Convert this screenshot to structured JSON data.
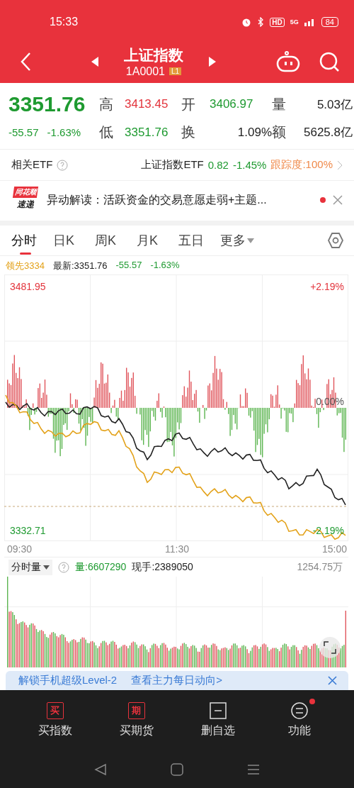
{
  "status_bar": {
    "time": "15:33",
    "hd": "HD",
    "network": "5G",
    "battery": "84"
  },
  "nav": {
    "title": "上证指数",
    "code": "1A0001",
    "level_badge": "L1"
  },
  "quote": {
    "price": "3351.76",
    "change": "-55.57",
    "change_pct": "-1.63%",
    "color": "#1e9a30",
    "stats": [
      {
        "label": "高",
        "value": "3413.45",
        "color": "#e3343c"
      },
      {
        "label": "开",
        "value": "3406.97",
        "color": "#1e9a30"
      },
      {
        "label": "量",
        "value": "5.03亿",
        "color": "#222222"
      },
      {
        "label": "低",
        "value": "3351.76",
        "color": "#1e9a30"
      },
      {
        "label": "换",
        "value": "1.09%",
        "color": "#222222"
      },
      {
        "label": "额",
        "value": "5625.8亿",
        "color": "#222222"
      }
    ]
  },
  "etf": {
    "label": "相关ETF",
    "name": "上证指数ETF",
    "price": "0.82",
    "change": "-1.45%",
    "tracking": "跟踪度:100%"
  },
  "news": {
    "logo_top": "同花顺",
    "logo_bottom": "速递",
    "text": "异动解读：活跃资金的交易意愿走弱+主题...",
    "unread": true
  },
  "tabs": [
    {
      "label": "分时",
      "selected": true
    },
    {
      "label": "日K",
      "selected": false
    },
    {
      "label": "周K",
      "selected": false
    },
    {
      "label": "月K",
      "selected": false
    },
    {
      "label": "五日",
      "selected": false
    },
    {
      "label": "更多",
      "selected": false,
      "dropdown": true
    }
  ],
  "chart_info": {
    "leader": "领先3334",
    "latest": "最新:3351.76",
    "change": "-55.57",
    "change_pct": "-1.63%"
  },
  "chart": {
    "price_labels": [
      "3481.95",
      "3332.71"
    ],
    "percent_labels": [
      "+2.19%",
      "0.00%",
      "-2.19%"
    ],
    "time_labels": [
      "09:30",
      "11:30",
      "15:00"
    ]
  },
  "volume": {
    "selector": "分时量",
    "total": "量:6607290",
    "current": "现手:2389050",
    "max": "1254.75万"
  },
  "banner": {
    "text": "解锁手机超级Level-2",
    "link": "查看主力每日动向>"
  },
  "bottom_nav": [
    {
      "kind": "buy",
      "icon_char": "买",
      "label": "买指数",
      "badge": false
    },
    {
      "kind": "buy",
      "icon_char": "期",
      "label": "买期货",
      "badge": false
    },
    {
      "kind": "remove",
      "label": "删自选",
      "badge": false
    },
    {
      "kind": "menu",
      "label": "功能",
      "badge": true
    }
  ]
}
